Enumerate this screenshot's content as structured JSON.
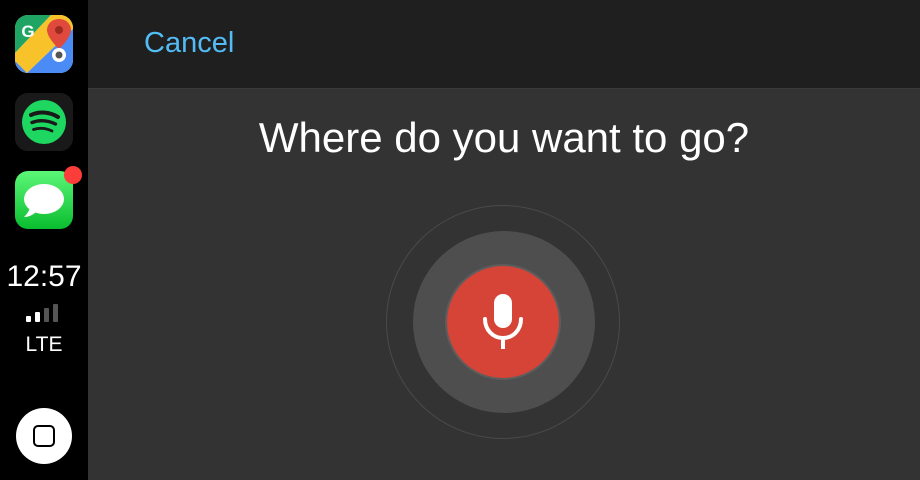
{
  "sidebar": {
    "apps": [
      {
        "name": "Google Maps",
        "icon": "google-maps-icon"
      },
      {
        "name": "Spotify",
        "icon": "spotify-icon"
      },
      {
        "name": "Messages",
        "icon": "messages-icon",
        "has_badge": true
      }
    ],
    "status": {
      "time": "12:57",
      "network": "LTE",
      "signal_bars_active": 2,
      "signal_bars_total": 4
    },
    "home_icon": "home-button-icon"
  },
  "header": {
    "cancel_label": "Cancel"
  },
  "voice": {
    "prompt": "Where do you want to go?",
    "mic_icon": "microphone-icon"
  },
  "colors": {
    "accent_link": "#53bcf5",
    "mic_red": "#d64337",
    "badge_red": "#fc3d39",
    "background": "#333333"
  }
}
